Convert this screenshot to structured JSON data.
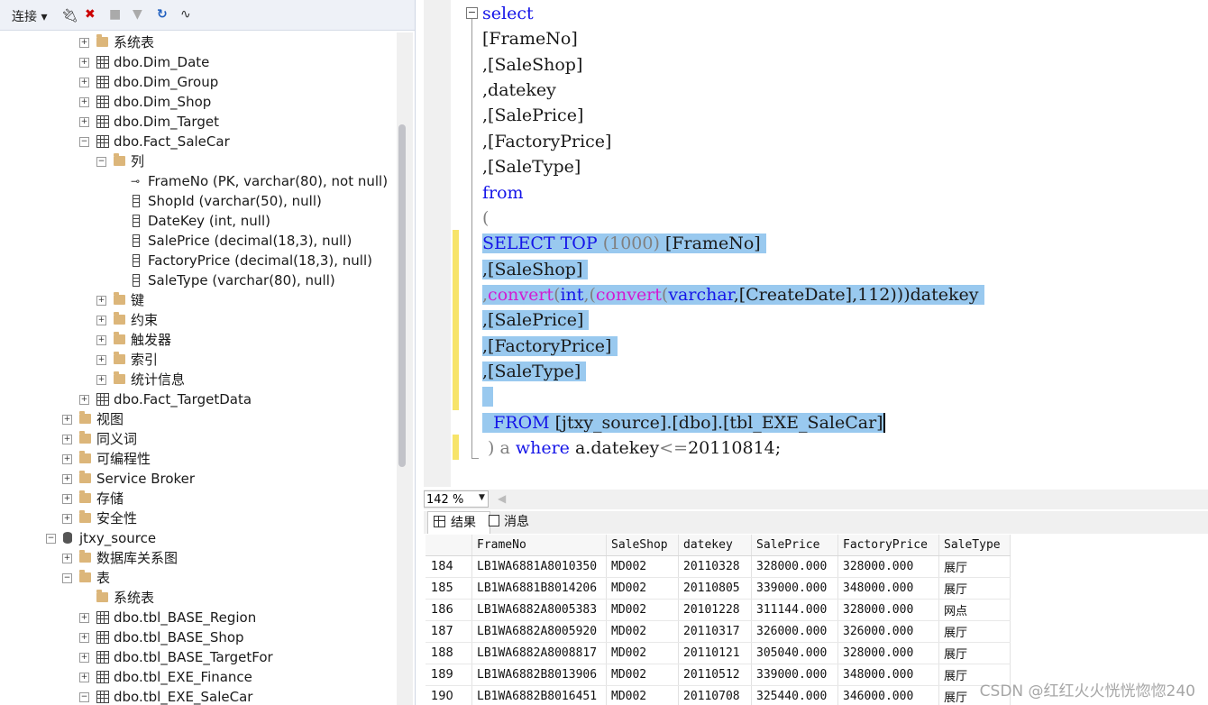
{
  "toolbar": {
    "connect_label": "连接 ▾"
  },
  "tree": {
    "system_tables": "系统表",
    "dim_date": "dbo.Dim_Date",
    "dim_group": "dbo.Dim_Group",
    "dim_shop": "dbo.Dim_Shop",
    "dim_target": "dbo.Dim_Target",
    "fact_salecar": "dbo.Fact_SaleCar",
    "columns": "列",
    "col_frameno": "FrameNo (PK, varchar(80), not null)",
    "col_shopid": "ShopId (varchar(50), null)",
    "col_datekey": "DateKey (int, null)",
    "col_saleprice": "SalePrice (decimal(18,3), null)",
    "col_factoryprice": "FactoryPrice (decimal(18,3), null)",
    "col_saletype": "SaleType (varchar(80), null)",
    "keys": "键",
    "constraints": "约束",
    "triggers": "触发器",
    "indexes": "索引",
    "statistics": "统计信息",
    "fact_targetdata": "dbo.Fact_TargetData",
    "views": "视图",
    "synonyms": "同义词",
    "programmability": "可编程性",
    "service_broker": "Service Broker",
    "storage": "存储",
    "security": "安全性",
    "db_jtxy": "jtxy_source",
    "db_diagrams": "数据库关系图",
    "tables": "表",
    "system_tables2": "系统表",
    "base_region": "dbo.tbl_BASE_Region",
    "base_shop": "dbo.tbl_BASE_Shop",
    "base_targetfor": "dbo.tbl_BASE_TargetFor",
    "exe_finance": "dbo.tbl_EXE_Finance",
    "exe_salecar": "dbo.tbl_EXE_SaleCar"
  },
  "editor": {
    "line1": "select",
    "line2": "[FrameNo]",
    "line3": ",[SaleShop]",
    "line4": ",datekey",
    "line5": ",[SalePrice]",
    "line6": ",[FactoryPrice]",
    "line7": ",[SaleType]",
    "line8": "from",
    "line9": "(",
    "line10a": "SELECT TOP ",
    "line10b": "(1000) ",
    "line10c": "[FrameNo]",
    "line11": ",[SaleShop]",
    "line12a": ",",
    "line12b": "convert",
    "line12c": "(",
    "line12d": "int",
    "line12e": ",(",
    "line12f": "convert",
    "line12g": "(",
    "line12h": "varchar",
    "line12i": ",[CreateDate],112)))datekey",
    "line13": ",[SalePrice]",
    "line14": ",[FactoryPrice]",
    "line15": ",[SaleType]",
    "line17a": "  FROM ",
    "line17b": "[jtxy_source].[dbo].[tbl_EXE_SaleCar]",
    "line18a": " ) a ",
    "line18b": "where",
    "line18c": " a.datekey",
    "line18d": "<=",
    "line18e": "20110814;"
  },
  "zoom": {
    "value": "142 %"
  },
  "result_tabs": {
    "results": "结果",
    "messages": "消息"
  },
  "grid": {
    "columns": [
      "",
      "FrameNo",
      "SaleShop",
      "datekey",
      "SalePrice",
      "FactoryPrice",
      "SaleType"
    ],
    "rows": [
      [
        "184",
        "LB1WA6881A8010350",
        "MD002",
        "20110328",
        "328000.000",
        "328000.000",
        "展厅"
      ],
      [
        "185",
        "LB1WA6881B8014206",
        "MD002",
        "20110805",
        "339000.000",
        "348000.000",
        "展厅"
      ],
      [
        "186",
        "LB1WA6882A8005383",
        "MD002",
        "20101228",
        "311144.000",
        "328000.000",
        "网点"
      ],
      [
        "187",
        "LB1WA6882A8005920",
        "MD002",
        "20110317",
        "326000.000",
        "326000.000",
        "展厅"
      ],
      [
        "188",
        "LB1WA6882A8008817",
        "MD002",
        "20110121",
        "305040.000",
        "328000.000",
        "展厅"
      ],
      [
        "189",
        "LB1WA6882B8013906",
        "MD002",
        "20110512",
        "339000.000",
        "348000.000",
        "展厅"
      ],
      [
        "190",
        "LB1WA6882B8016451",
        "MD002",
        "20110708",
        "325440.000",
        "346000.000",
        "展厅"
      ]
    ]
  },
  "watermark": "CSDN @红红火火恍恍惚惚240"
}
